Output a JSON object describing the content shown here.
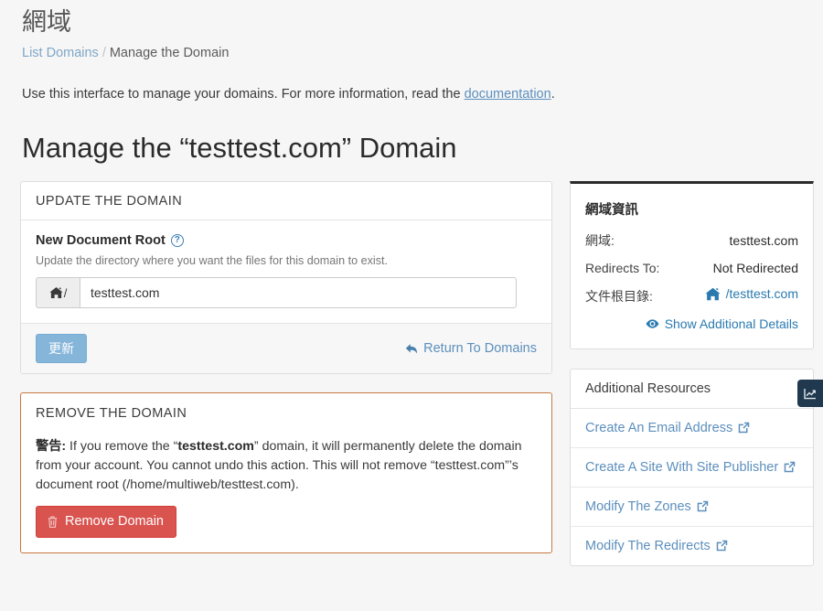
{
  "header": {
    "title": "網域",
    "breadcrumb": {
      "link": "List Domains",
      "separator": "/",
      "current": "Manage the Domain"
    },
    "intro_before": "Use this interface to manage your domains. For more information, read the ",
    "intro_link": "documentation",
    "intro_after": "."
  },
  "page_title": "Manage the “testtest.com” Domain",
  "update_card": {
    "heading": "UPDATE THE DOMAIN",
    "field_label": "New Document Root",
    "help_icon": "question-circle-icon",
    "field_hint": "Update the directory where you want the files for this domain to exist.",
    "input_prefix": "/",
    "input_prefix_icon": "home-icon",
    "input_value": "testtest.com",
    "update_button": "更新",
    "return_link": "Return To Domains",
    "return_icon": "arrow-return-icon"
  },
  "remove_card": {
    "heading": "REMOVE THE DOMAIN",
    "warn_label": "警告:",
    "warn_part1": " If you remove the “",
    "warn_domain": "testtest.com",
    "warn_part2": "” domain, it will permanently delete the domain from your account. You cannot undo this action. This will not remove “testtest.com”’s document root (/home/multiweb/testtest.com).",
    "remove_button": "Remove Domain",
    "remove_icon": "trash-icon"
  },
  "sidebar": {
    "info_title": "網域資訊",
    "rows": [
      {
        "key": "網域:",
        "value": "testtest.com",
        "is_link": false
      },
      {
        "key": "Redirects To:",
        "value": "Not Redirected",
        "is_link": false
      },
      {
        "key": "文件根目錄:",
        "value": "/testtest.com",
        "is_link": true,
        "icon": "home-icon"
      }
    ],
    "show_details": "Show Additional Details",
    "show_details_icon": "eye-icon",
    "resources_heading": "Additional Resources",
    "resources": [
      {
        "label": "Create An Email Address",
        "icon": "external-link-icon"
      },
      {
        "label": "Create A Site With Site Publisher",
        "icon": "external-link-icon"
      },
      {
        "label": "Modify The Zones",
        "icon": "external-link-icon"
      },
      {
        "label": "Modify The Redirects",
        "icon": "external-link-icon"
      }
    ]
  },
  "float_tab": {
    "icon": "line-chart-icon"
  },
  "colors": {
    "page_bg": "#f6f6f6",
    "primary_blue": "#85b5d9",
    "link_blue": "#5c8fbd",
    "accent_blue": "#2a7ab0",
    "danger_red": "#d9534f",
    "danger_border": "#c87941",
    "dark_tab": "#21394f"
  }
}
